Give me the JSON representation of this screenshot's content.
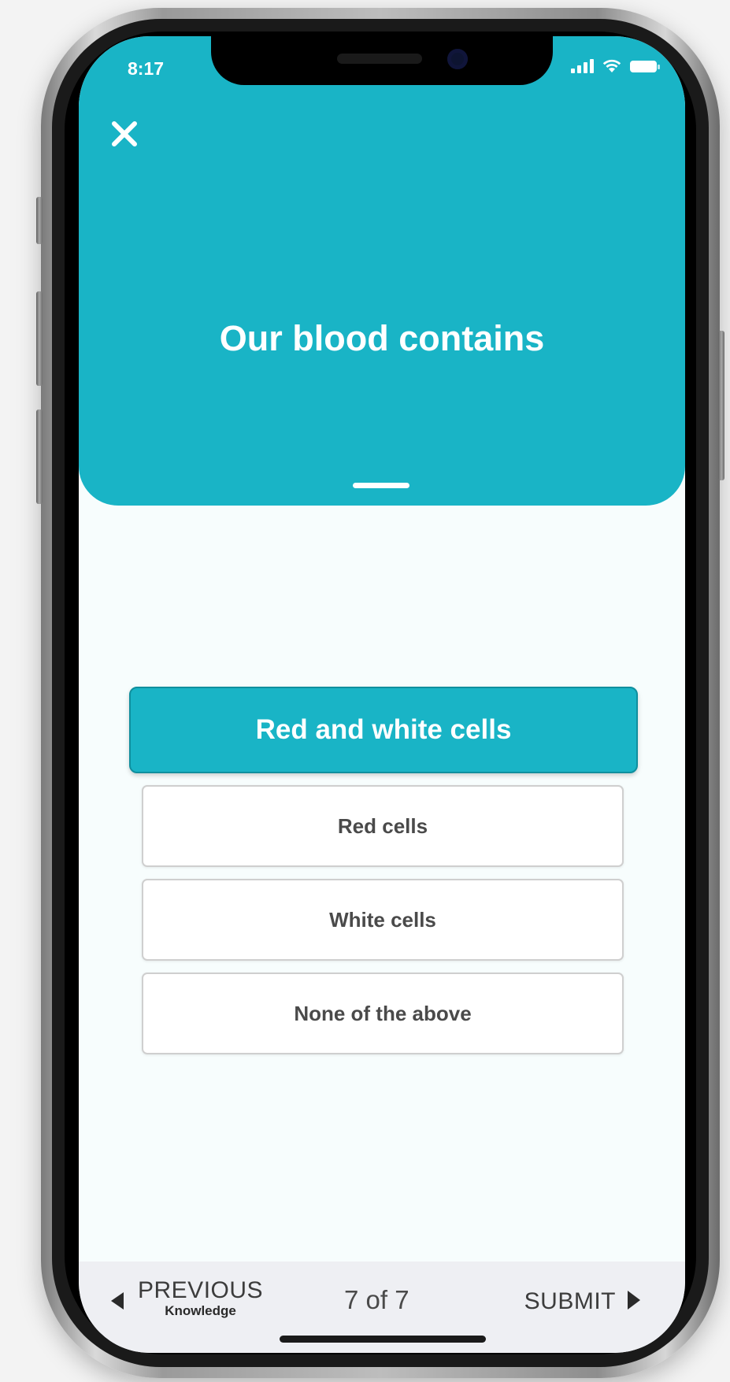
{
  "status_bar": {
    "time": "8:17"
  },
  "header": {
    "close_icon": "close-icon",
    "question": "Our blood contains",
    "background_color": "#19b4c6"
  },
  "answers": {
    "selected": "Red and white cells",
    "options": [
      "Red cells",
      "White cells",
      "None of the above"
    ]
  },
  "bottom_nav": {
    "previous_label": "PREVIOUS",
    "previous_sub": "Knowledge",
    "page_indicator": "7 of 7",
    "submit_label": "SUBMIT"
  },
  "colors": {
    "accent": "#19b4c6",
    "nav_background": "#eeeff3"
  }
}
